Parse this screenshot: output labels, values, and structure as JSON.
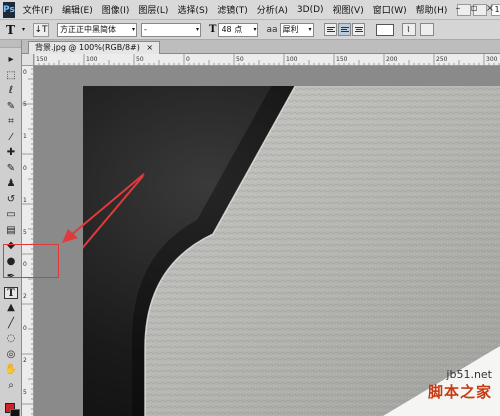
{
  "app": {
    "logo": "Ps"
  },
  "menu": {
    "items": [
      "文件(F)",
      "编辑(E)",
      "图像(I)",
      "图层(L)",
      "选择(S)",
      "滤镜(T)",
      "分析(A)",
      "3D(D)",
      "视图(V)",
      "窗口(W)",
      "帮助(H)"
    ],
    "zoom": "100%"
  },
  "options": {
    "tool_icon": "T",
    "orientation_icon": "↓T",
    "font_family": "方正正中黑简体",
    "font_style": "-",
    "size_icon": "T",
    "font_size": "48 点",
    "antialias_icon": "aa",
    "antialias": "犀利"
  },
  "document": {
    "tab_title": "背景.jpg @ 100%(RGB/8#)",
    "close": "×"
  },
  "colors": {
    "foreground": "#d0202a",
    "background": "#111111",
    "annotation": "#e03a3a"
  },
  "tools": [
    {
      "name": "move-tool",
      "glyph": "▸"
    },
    {
      "name": "marquee-tool",
      "glyph": "⬚"
    },
    {
      "name": "lasso-tool",
      "glyph": "ℓ"
    },
    {
      "name": "quick-select-tool",
      "glyph": "✎"
    },
    {
      "name": "crop-tool",
      "glyph": "⌗"
    },
    {
      "name": "eyedropper-tool",
      "glyph": "⁄"
    },
    {
      "name": "healing-tool",
      "glyph": "✚"
    },
    {
      "name": "brush-tool",
      "glyph": "✎"
    },
    {
      "name": "clone-stamp-tool",
      "glyph": "♟"
    },
    {
      "name": "history-brush-tool",
      "glyph": "↺"
    },
    {
      "name": "eraser-tool",
      "glyph": "▭"
    },
    {
      "name": "gradient-tool",
      "glyph": "▤"
    },
    {
      "name": "blur-tool",
      "glyph": "◆"
    },
    {
      "name": "dodge-tool",
      "glyph": "●"
    },
    {
      "name": "pen-tool",
      "glyph": "✒"
    },
    {
      "name": "type-tool",
      "glyph": "T"
    },
    {
      "name": "path-select-tool",
      "glyph": "▲"
    },
    {
      "name": "shape-tool",
      "glyph": "╱"
    },
    {
      "name": "3d-rotate-tool",
      "glyph": "◌"
    },
    {
      "name": "3d-orbit-tool",
      "glyph": "◎"
    },
    {
      "name": "hand-tool",
      "glyph": "✋"
    },
    {
      "name": "zoom-tool",
      "glyph": "⌕"
    }
  ],
  "ruler_h_labels": [
    "150",
    "100",
    "50",
    "0",
    "50",
    "100",
    "150",
    "200",
    "250",
    "300",
    "350",
    "400"
  ],
  "ruler_v_labels": [
    "0",
    "5",
    "1",
    "0",
    "1",
    "5",
    "0",
    "2",
    "0",
    "2",
    "5"
  ],
  "watermark": {
    "line1": "jb51.net",
    "line2": "脚本之家"
  },
  "window_controls": [
    "–",
    "▫",
    "×"
  ]
}
